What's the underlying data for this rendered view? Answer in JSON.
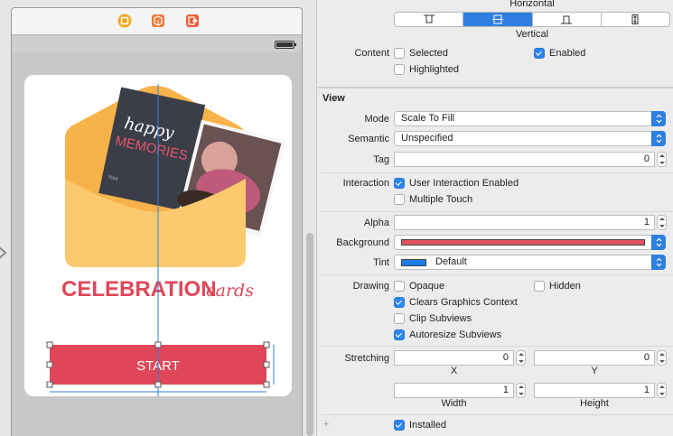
{
  "canvas": {
    "card_title": "CELEBRATION",
    "card_title_script": "cards",
    "photo_caption_1": "happy",
    "photo_caption_2": "MEMORIES",
    "photo_caption_small": "Your",
    "start_button_label": "START",
    "colors": {
      "brand_red": "#df4759",
      "envelope": "#f8c45f"
    }
  },
  "inspector": {
    "horizontal_label": "Horizontal",
    "vertical_label": "Vertical",
    "content_label": "Content",
    "content_selected": "Selected",
    "content_enabled": "Enabled",
    "content_highlighted": "Highlighted",
    "view_section": "View",
    "mode_label": "Mode",
    "mode_value": "Scale To Fill",
    "semantic_label": "Semantic",
    "semantic_value": "Unspecified",
    "tag_label": "Tag",
    "tag_value": "0",
    "interaction_label": "Interaction",
    "user_interaction": "User Interaction Enabled",
    "multiple_touch": "Multiple Touch",
    "alpha_label": "Alpha",
    "alpha_value": "1",
    "background_label": "Background",
    "background_color": "#e0545e",
    "tint_label": "Tint",
    "tint_value": "Default",
    "tint_color": "#1b7de8",
    "drawing_label": "Drawing",
    "opaque": "Opaque",
    "hidden": "Hidden",
    "clears_graphics": "Clears Graphics Context",
    "clip_subviews": "Clip Subviews",
    "autoresize_subviews": "Autoresize Subviews",
    "stretching_label": "Stretching",
    "stretch_x": "0",
    "stretch_y": "0",
    "x_label": "X",
    "y_label": "Y",
    "stretch_w": "1",
    "stretch_h": "1",
    "width_label": "Width",
    "height_label": "Height",
    "installed": "Installed",
    "plus": "+"
  }
}
